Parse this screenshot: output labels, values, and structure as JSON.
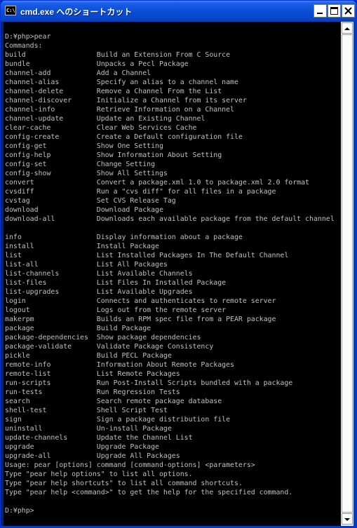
{
  "window": {
    "title": "cmd.exe へのショートカット",
    "icon_label": "C:\\",
    "icon_name": "console-icon"
  },
  "controls": {
    "minimize": "minimize-icon",
    "maximize": "maximize-icon",
    "close": "close-icon"
  },
  "console": {
    "lines": [
      "D:¥php>pear",
      "Commands:",
      "build                 Build an Extension From C Source",
      "bundle                Unpacks a Pecl Package",
      "channel-add           Add a Channel",
      "channel-alias         Specify an alias to a channel name",
      "channel-delete        Remove a Channel From the List",
      "channel-discover      Initialize a Channel from its server",
      "channel-info          Retrieve Information on a Channel",
      "channel-update        Update an Existing Channel",
      "clear-cache           Clear Web Services Cache",
      "config-create         Create a Default configuration file",
      "config-get            Show One Setting",
      "config-help           Show Information About Setting",
      "config-set            Change Setting",
      "config-show           Show All Settings",
      "convert               Convert a package.xml 1.0 to package.xml 2.0 format",
      "cvsdiff               Run a \"cvs diff\" for all files in a package",
      "cvstag                Set CVS Release Tag",
      "download              Download Package",
      "download-all          Downloads each available package from the default channel",
      "",
      "info                  Display information about a package",
      "install               Install Package",
      "list                  List Installed Packages In The Default Channel",
      "list-all              List All Packages",
      "list-channels         List Available Channels",
      "list-files            List Files In Installed Package",
      "list-upgrades         List Available Upgrades",
      "login                 Connects and authenticates to remote server",
      "logout                Logs out from the remote server",
      "makerpm               Builds an RPM spec file from a PEAR package",
      "package               Build Package",
      "package-dependencies  Show package dependencies",
      "package-validate      Validate Package Consistency",
      "pickle                Build PECL Package",
      "remote-info           Information About Remote Packages",
      "remote-list           List Remote Packages",
      "run-scripts           Run Post-Install Scripts bundled with a package",
      "run-tests             Run Regression Tests",
      "search                Search remote package database",
      "shell-test            Shell Script Test",
      "sign                  Sign a package distribution file",
      "uninstall             Un-install Package",
      "update-channels       Update the Channel List",
      "upgrade               Upgrade Package",
      "upgrade-all           Upgrade All Packages",
      "Usage: pear [options] command [command-options] <parameters>",
      "Type \"pear help options\" to list all options.",
      "Type \"pear help shortcuts\" to list all command shortcuts.",
      "Type \"pear help <command>\" to get the help for the specified command.",
      "",
      "D:¥php>"
    ]
  },
  "scrollbar": {
    "up": "scroll-up-arrow-icon",
    "down": "scroll-down-arrow-icon"
  }
}
